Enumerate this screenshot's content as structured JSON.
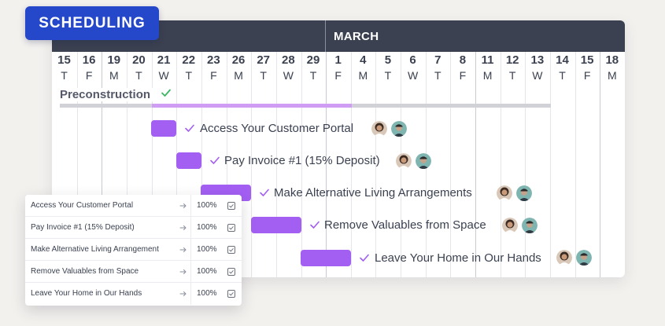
{
  "badge": {
    "label": "SCHEDULING"
  },
  "timeline": {
    "month_label": "MARCH",
    "days": [
      {
        "num": "15",
        "wd": "T"
      },
      {
        "num": "16",
        "wd": "F"
      },
      {
        "num": "19",
        "wd": "M"
      },
      {
        "num": "20",
        "wd": "T"
      },
      {
        "num": "21",
        "wd": "W"
      },
      {
        "num": "22",
        "wd": "T"
      },
      {
        "num": "23",
        "wd": "F"
      },
      {
        "num": "26",
        "wd": "M"
      },
      {
        "num": "27",
        "wd": "T"
      },
      {
        "num": "28",
        "wd": "W"
      },
      {
        "num": "29",
        "wd": "T"
      },
      {
        "num": "1",
        "wd": "F"
      },
      {
        "num": "4",
        "wd": "M"
      },
      {
        "num": "5",
        "wd": "T"
      },
      {
        "num": "6",
        "wd": "W"
      },
      {
        "num": "7",
        "wd": "T"
      },
      {
        "num": "8",
        "wd": "F"
      },
      {
        "num": "11",
        "wd": "M"
      },
      {
        "num": "12",
        "wd": "T"
      },
      {
        "num": "13",
        "wd": "W"
      },
      {
        "num": "14",
        "wd": "T"
      },
      {
        "num": "15",
        "wd": "F"
      },
      {
        "num": "18",
        "wd": "M"
      }
    ],
    "phase": {
      "label": "Preconstruction",
      "status_icon": "check-icon"
    },
    "tasks": [
      {
        "label": "Access Your Customer Portal",
        "status_icon": "check-icon"
      },
      {
        "label": "Pay Invoice #1 (15% Deposit)",
        "status_icon": "check-icon"
      },
      {
        "label": "Make Alternative Living Arrangements",
        "status_icon": "check-icon"
      },
      {
        "label": "Remove Valuables from Space",
        "status_icon": "check-icon"
      },
      {
        "label": "Leave Your Home in Our Hands",
        "status_icon": "check-icon"
      }
    ]
  },
  "task_list": {
    "rows": [
      {
        "name": "Access Your Customer Portal",
        "percent": "100%"
      },
      {
        "name": "Pay Invoice #1 (15% Deposit)",
        "percent": "100%"
      },
      {
        "name": "Make Alternative Living Arrangement",
        "percent": "100%"
      },
      {
        "name": "Remove Valuables from Space",
        "percent": "100%"
      },
      {
        "name": "Leave Your Home in Our Hands",
        "percent": "100%"
      }
    ]
  },
  "colors": {
    "header_bg": "#3b4150",
    "badge_bg": "#2547c9",
    "task_bar": "#a35ff2",
    "phase_fill": "#cf9df3",
    "check": "#3cb563",
    "task_check": "#a35ff2"
  }
}
